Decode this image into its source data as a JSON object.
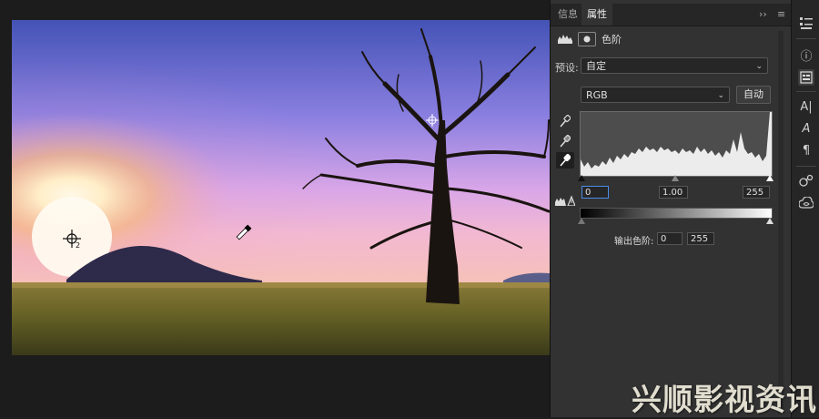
{
  "panel": {
    "tabs": [
      {
        "label": "信息",
        "active": false
      },
      {
        "label": "属性",
        "active": true
      }
    ],
    "collapse_glyph": "››",
    "menu_glyph": "≡",
    "header_title": "色阶",
    "preset_label": "预设:",
    "preset_value": "自定",
    "channel_value": "RGB",
    "auto_label": "自动",
    "input_black": "0",
    "input_gamma": "1.00",
    "input_white": "255",
    "output_label": "输出色阶:",
    "output_black": "0",
    "output_white": "255"
  },
  "rail": {
    "icons": [
      "adjust-list-icon",
      "info-icon",
      "properties-icon",
      "character-icon",
      "glyph-icon",
      "paragraph-icon",
      "share-icon",
      "cc-libraries-icon"
    ],
    "char_glyph": "A|",
    "glyph_glyph": "A",
    "para_glyph": "¶",
    "info_glyph": "ⓘ"
  },
  "canvas": {
    "cursor_sample_label": "2"
  },
  "watermark": {
    "text": "兴顺影视资讯网"
  },
  "colors": {
    "accent_focus": "#4a8de8",
    "panel_bg": "#323232"
  }
}
